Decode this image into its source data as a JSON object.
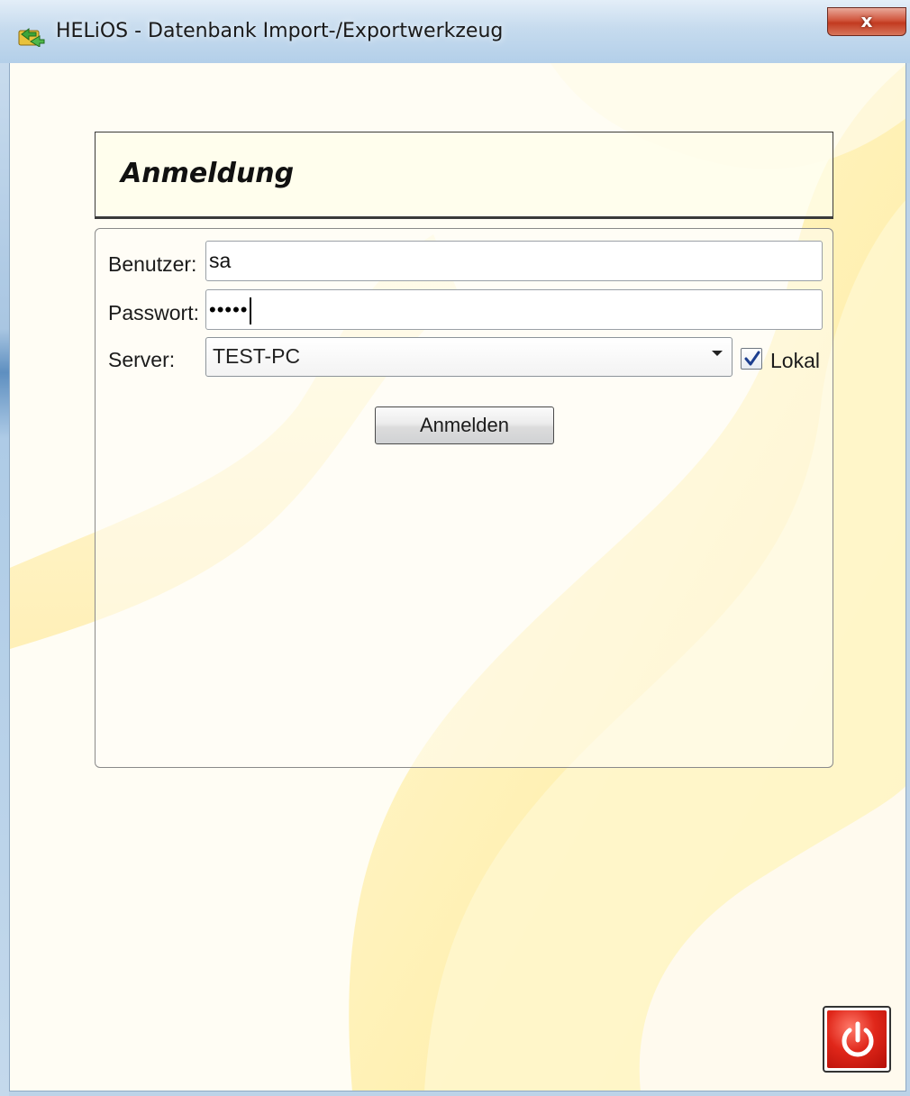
{
  "window": {
    "title": "HELiOS - Datenbank Import-/Exportwerkzeug",
    "close_label": "x"
  },
  "login": {
    "header_title": "Anmeldung",
    "user_label": "Benutzer:",
    "user_value": "sa",
    "password_label": "Passwort:",
    "password_mask": "•••••",
    "server_label": "Server:",
    "server_value": "TEST-PC",
    "local_label": "Lokal",
    "local_checked": true,
    "submit_label": "Anmelden"
  },
  "icons": {
    "app": "helios-app-icon",
    "close": "close-icon",
    "dropdown": "chevron-down-icon",
    "check": "checkmark-icon",
    "power": "power-icon"
  },
  "colors": {
    "accent_close": "#c23a20",
    "power_button": "#e0271a",
    "background": "#fffdf4",
    "highlight_yellow": "#ffe680"
  }
}
